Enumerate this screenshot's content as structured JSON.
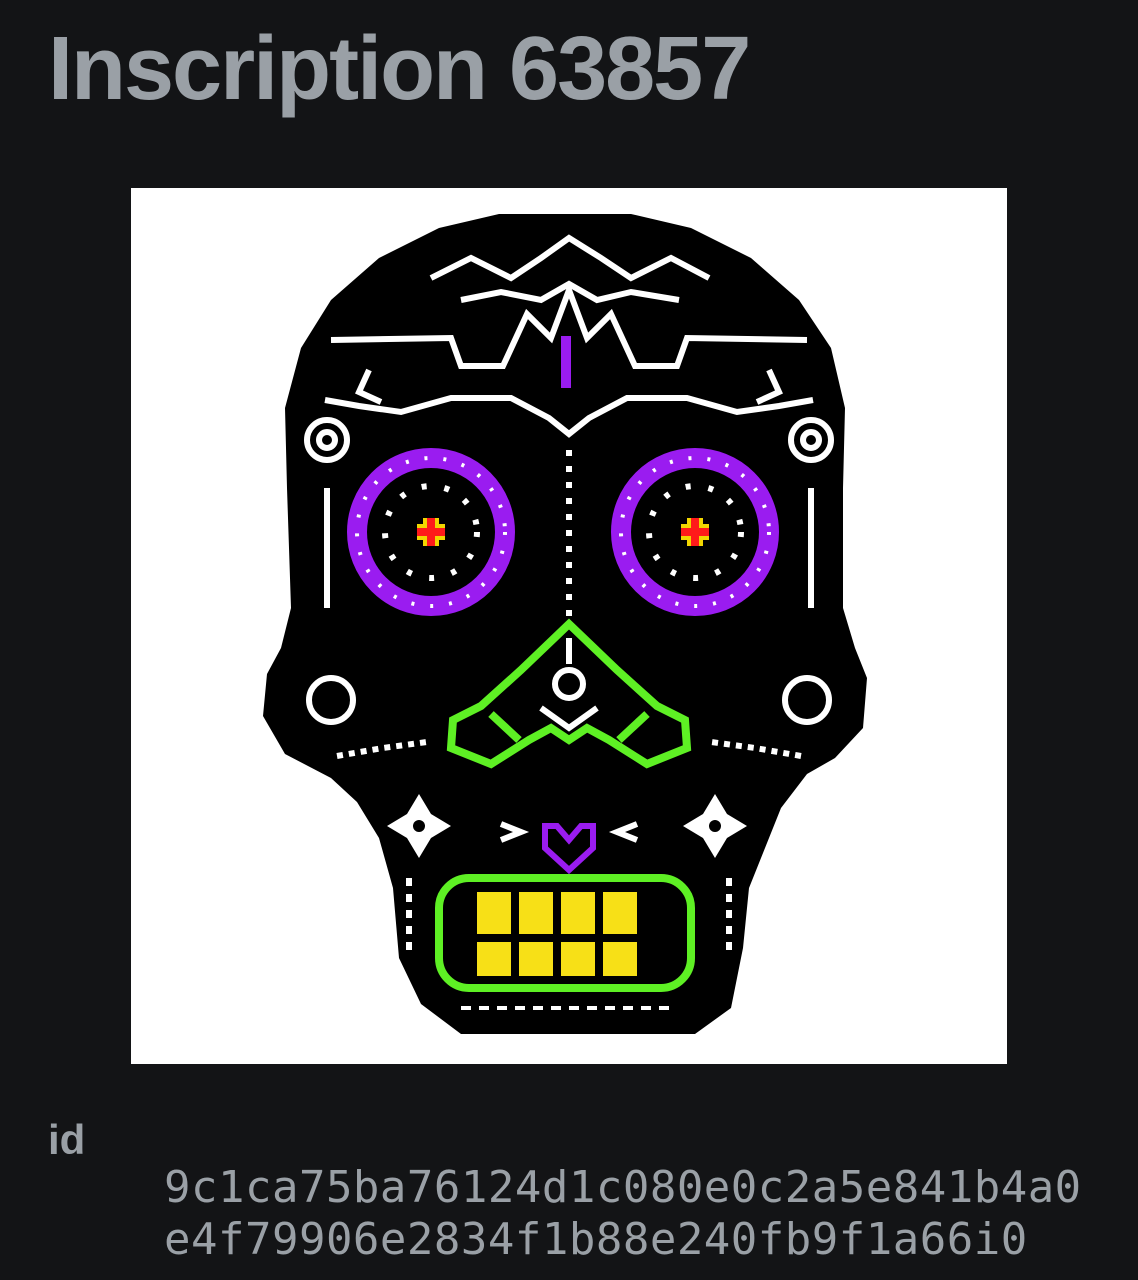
{
  "page": {
    "title": "Inscription 63857"
  },
  "artwork": {
    "name": "sugar-skull",
    "colors": {
      "background": "#ffffff",
      "skull": "#000000",
      "ornament": "#ffffff",
      "eyes": "#9a1cf0",
      "eye_center": "#f2d600",
      "eye_cross": "#ff1a1a",
      "nose": "#5ef024",
      "mouth_outline": "#5ef024",
      "teeth": "#f7e017",
      "chin_heart": "#9a1cf0"
    }
  },
  "details": {
    "id_label": "id",
    "id_value": "9c1ca75ba76124d1c080e0c2a5e841b4a0e4f79906e2834f1b88e240fb9f1a66i0"
  }
}
